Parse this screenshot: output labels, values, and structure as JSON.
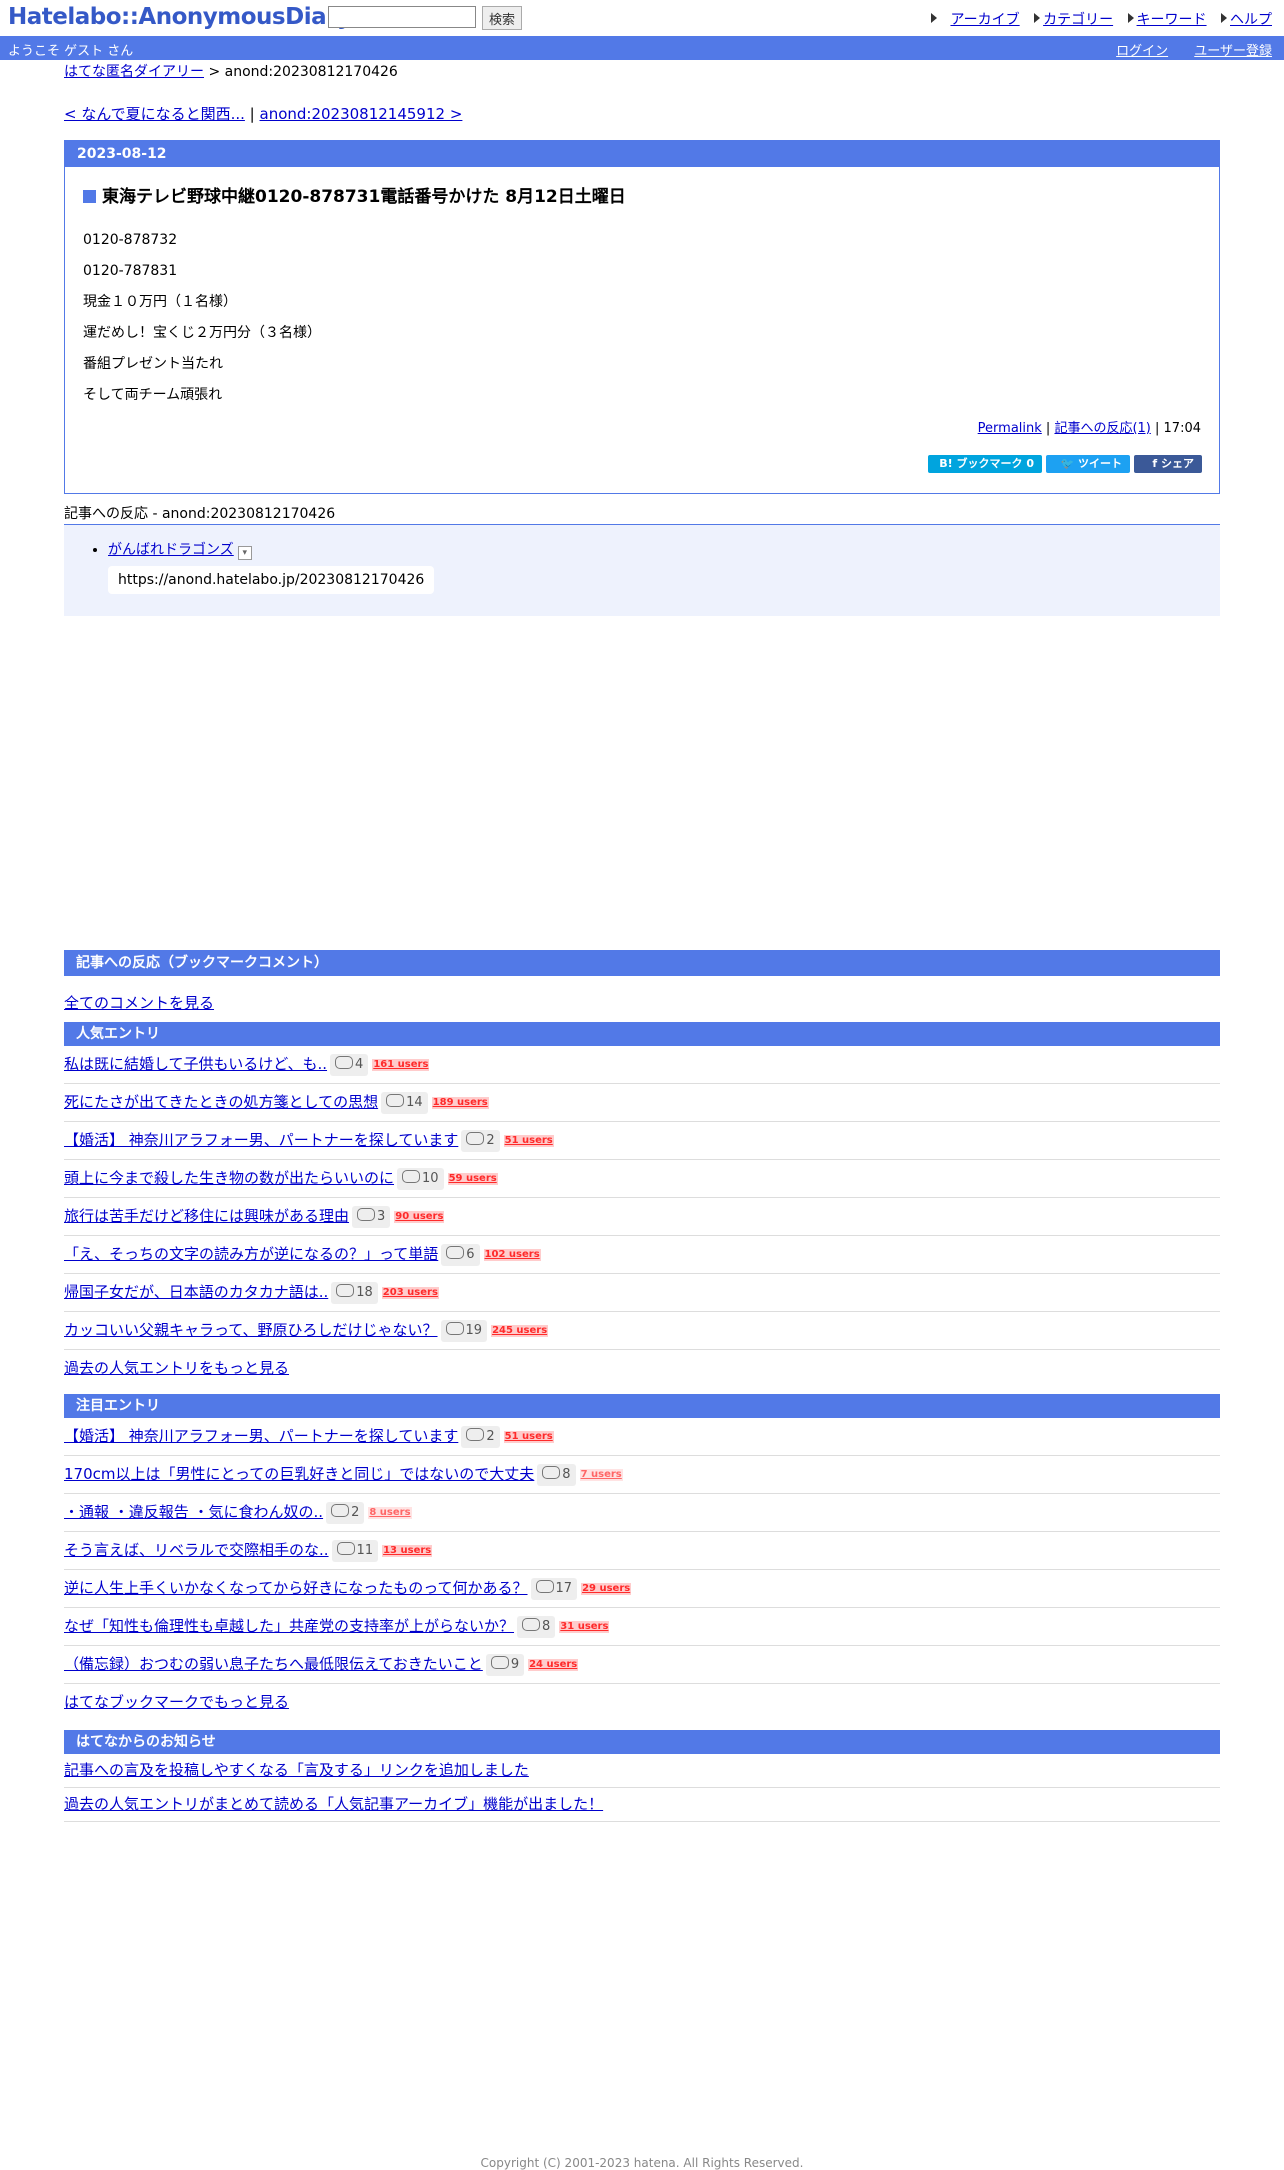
{
  "header": {
    "logo": "Hatelabo::AnonymousDiary",
    "search_placeholder": "",
    "search_button": "検索",
    "nav": [
      "アーカイブ",
      "カテゴリー",
      "キーワード",
      "ヘルプ"
    ]
  },
  "welcome": {
    "greeting": "ようこそ ゲスト さん",
    "login": "ログイン",
    "register": "ユーザー登録"
  },
  "breadcrumb": {
    "home": "はてな匿名ダイアリー",
    "sep": " > ",
    "current": "anond:20230812170426"
  },
  "prevnext": {
    "prev": "< なんで夏になると関西...",
    "sep": " | ",
    "next": "anond:20230812145912 >"
  },
  "article": {
    "date": "2023-08-12",
    "title": "東海テレビ野球中継0120-878731電話番号かけた 8月12日土曜日",
    "body": [
      "0120-878732",
      "0120-787831",
      "現金１０万円（１名様）",
      "運だめし！宝くじ２万円分（３名様）",
      "番組プレゼント当たれ",
      "そして両チーム頑張れ"
    ],
    "permalink": "Permalink",
    "reactions_link": "記事への反応(1)",
    "time": "17:04",
    "share": {
      "bookmark": "B! ブックマーク  0",
      "tweet": "ツイート",
      "facebook": "シェア"
    }
  },
  "reactions": {
    "heading": "記事への反応 - anond:20230812170426",
    "items": [
      {
        "title": "がんばれドラゴンズ",
        "quote": "https://anond.hatelabo.jp/20230812170426"
      }
    ]
  },
  "bookmark_comments": {
    "heading": "記事への反応（ブックマークコメント）",
    "all": "全てのコメントを見る"
  },
  "popular": {
    "heading": "人気エントリ",
    "items": [
      {
        "title": "私は既に結婚して子供もいるけど、も..",
        "count": "4",
        "users": "161 users"
      },
      {
        "title": "死にたさが出てきたときの処方箋としての思想",
        "count": "14",
        "users": "189 users"
      },
      {
        "title": "【婚活】 神奈川アラフォー男、パートナーを探しています",
        "count": "2",
        "users": "51 users"
      },
      {
        "title": "頭上に今まで殺した生き物の数が出たらいいのに",
        "count": "10",
        "users": "59 users"
      },
      {
        "title": "旅行は苦手だけど移住には興味がある理由",
        "count": "3",
        "users": "90 users"
      },
      {
        "title": "「え、そっちの文字の読み方が逆になるの？」って単語",
        "count": "6",
        "users": "102 users"
      },
      {
        "title": "帰国子女だが、日本語のカタカナ語は..",
        "count": "18",
        "users": "203 users"
      },
      {
        "title": "カッコいい父親キャラって、野原ひろしだけじゃない？",
        "count": "19",
        "users": "245 users"
      }
    ],
    "more": "過去の人気エントリをもっと見る"
  },
  "noticed": {
    "heading": "注目エントリ",
    "items": [
      {
        "title": "【婚活】 神奈川アラフォー男、パートナーを探しています",
        "count": "2",
        "users": "51 users",
        "light": false
      },
      {
        "title": "170cm以上は「男性にとっての巨乳好きと同じ」ではないので大丈夫",
        "count": "8",
        "users": "7 users",
        "light": true
      },
      {
        "title": "・通報 ・違反報告 ・気に食わん奴の..",
        "count": "2",
        "users": "8 users",
        "light": true
      },
      {
        "title": "そう言えば、リベラルで交際相手のな..",
        "count": "11",
        "users": "13 users",
        "light": false
      },
      {
        "title": "逆に人生上手くいかなくなってから好きになったものって何かある？",
        "count": "17",
        "users": "29 users",
        "light": false
      },
      {
        "title": "なぜ「知性も倫理性も卓越した」共産党の支持率が上がらないか？",
        "count": "8",
        "users": "31 users",
        "light": false
      },
      {
        "title": "（備忘録）おつむの弱い息子たちへ最低限伝えておきたいこと",
        "count": "9",
        "users": "24 users",
        "light": false
      }
    ],
    "more": "はてなブックマークでもっと見る"
  },
  "news": {
    "heading": "はてなからのお知らせ",
    "items": [
      "記事への言及を投稿しやすくなる「言及する」リンクを追加しました",
      "過去の人気エントリがまとめて読める「人気記事アーカイブ」機能が出ました！"
    ]
  },
  "copyright": "Copyright (C) 2001-2023 hatena. All Rights Reserved."
}
